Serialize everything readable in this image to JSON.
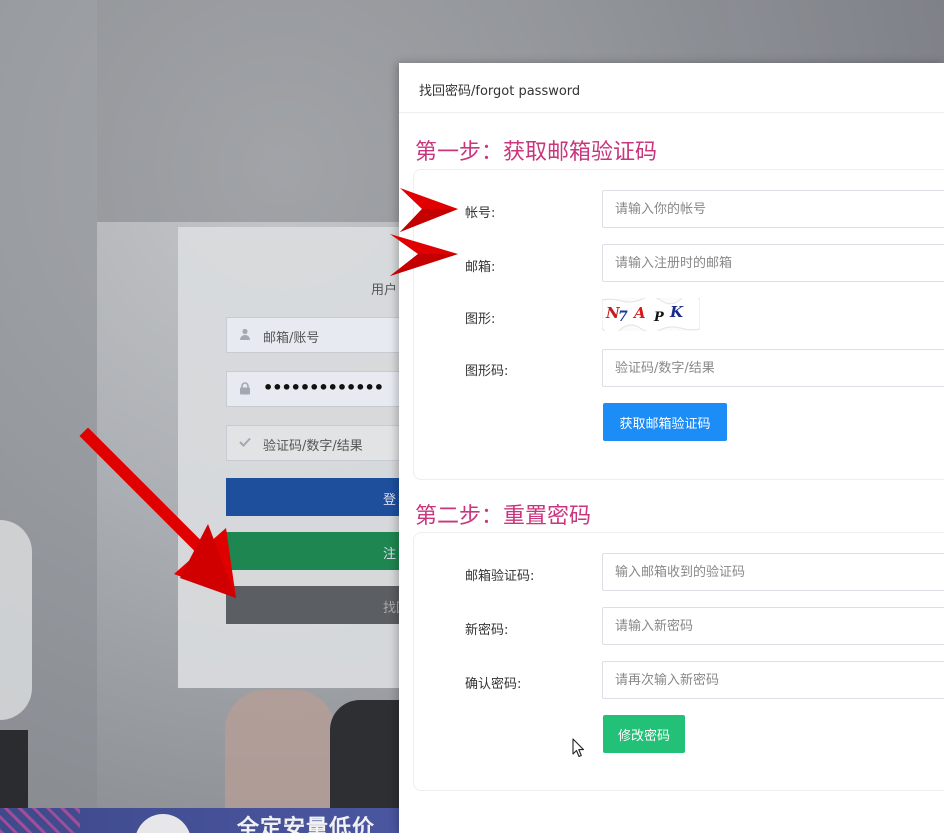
{
  "background": {
    "login": {
      "title": "用户",
      "account_placeholder": "邮箱/账号",
      "password_mask": "•••••••••••••",
      "captcha_placeholder": "验证码/数字/结果",
      "login_button": "登",
      "register_button": "注",
      "find_button": "找回"
    },
    "banner_text": "全定安量低价"
  },
  "modal": {
    "title": "找回密码/forgot password",
    "step1": {
      "heading": "第一步：获取邮箱验证码",
      "account_label": "帐号:",
      "account_placeholder": "请输入你的帐号",
      "email_label": "邮箱:",
      "email_placeholder": "请输入注册时的邮箱",
      "captcha_image_label": "图形:",
      "captcha_image_text": "N7APK",
      "captcha_code_label": "图形码:",
      "captcha_code_placeholder": "验证码/数字/结果",
      "get_code_button": "获取邮箱验证码"
    },
    "step2": {
      "heading": "第二步：重置密码",
      "email_code_label": "邮箱验证码:",
      "email_code_placeholder": "输入邮箱收到的验证码",
      "new_password_label": "新密码:",
      "new_password_placeholder": "请输入新密码",
      "confirm_password_label": "确认密码:",
      "confirm_password_placeholder": "请再次输入新密码",
      "submit_button": "修改密码"
    }
  },
  "colors": {
    "step_heading": "#c9367d",
    "primary_blue": "#1c8cf7",
    "success_green": "#23c077",
    "annotation_red": "#e00000"
  },
  "icons": [
    "user-icon",
    "lock-icon",
    "check-icon",
    "red-arrow-annotation",
    "mouse-cursor-icon"
  ]
}
